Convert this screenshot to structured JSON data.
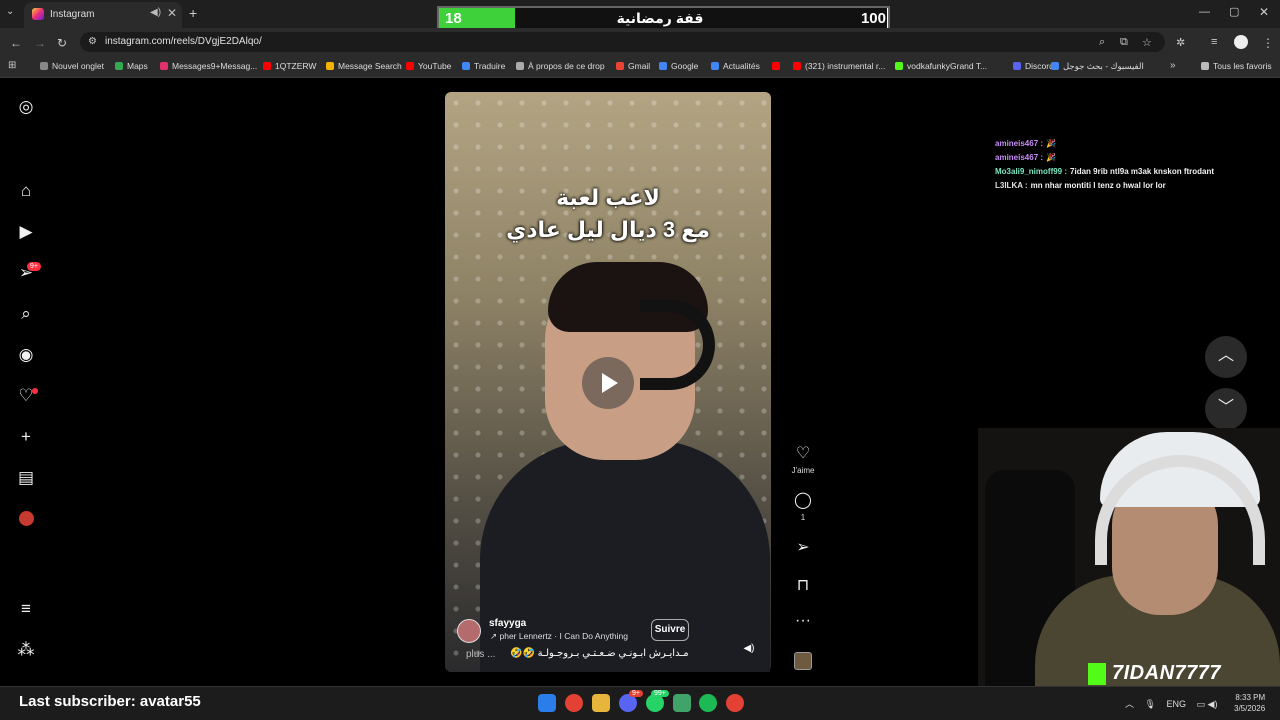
{
  "browser": {
    "tab_title": "Instagram",
    "url": "instagram.com/reels/DVgjE2DAlqo/",
    "bookmarks": [
      {
        "label": "Nouvel onglet",
        "color": "#888888"
      },
      {
        "label": "Maps",
        "color": "#34a853"
      },
      {
        "label": "Messages9+Messag...",
        "color": "#e1306c"
      },
      {
        "label": "1QTZERW",
        "color": "#ff0000"
      },
      {
        "label": "Message Search",
        "color": "#f4b400"
      },
      {
        "label": "YouTube",
        "color": "#ff0000"
      },
      {
        "label": "Traduire",
        "color": "#4285f4"
      },
      {
        "label": "À propos de ce drop",
        "color": "#aaaaaa"
      },
      {
        "label": "Gmail",
        "color": "#ea4335"
      },
      {
        "label": "Google",
        "color": "#4285f4"
      },
      {
        "label": "Actualités",
        "color": "#4285f4"
      },
      {
        "label": "",
        "color": "#ff0000"
      },
      {
        "label": "(321) instrumental r...",
        "color": "#ff0000"
      },
      {
        "label": "vodkafunkyGrand T...",
        "color": "#53fc18"
      },
      {
        "label": "Discord",
        "color": "#5865f2"
      },
      {
        "label": "الفيسبوك - بحث جوجل",
        "color": "#4285f4"
      }
    ],
    "all_favorites": "Tous les favoris"
  },
  "ramadan_bar": {
    "current": "18",
    "title": "قفة رمضانية",
    "goal": "100"
  },
  "sidebar": {
    "badge": "9+"
  },
  "reel": {
    "caption_line1": "لاعب لعبة",
    "caption_line2": "مع 3 ديال ليل عادي",
    "username": "sfayyga",
    "music": "pher Lennertz · I Can Do Anything",
    "follow_label": "Suivre",
    "description_more": "plus ...",
    "description": "مـدايـرش ابـونـي ضـعـتـي بـروجـولـة 🤣🤣",
    "like_label": "J'aime",
    "comment_count": "1"
  },
  "chat": [
    {
      "user": "amineis467 :",
      "message": "🎉",
      "user_class": "u1"
    },
    {
      "user": "amineis467 :",
      "message": "🎉",
      "user_class": "u1"
    },
    {
      "user": "Mo3ali9_nimoff99 :",
      "message": "7idan 9rib ntl9a m3ak knskon ftrodant",
      "user_class": "u2"
    },
    {
      "user": "L3ILKA :",
      "message": "mn nhar montiti l tenz o hwal lor lor",
      "user_class": "u3"
    }
  ],
  "stream": {
    "last_subscriber": "Last subscriber: avatar55",
    "channel_name": "7IDAN7777"
  },
  "taskbar": {
    "language": "ENG",
    "time": "8:33 PM",
    "date": "3/5/2026",
    "badge_discord": "9+",
    "badge_whatsapp": "99+"
  }
}
